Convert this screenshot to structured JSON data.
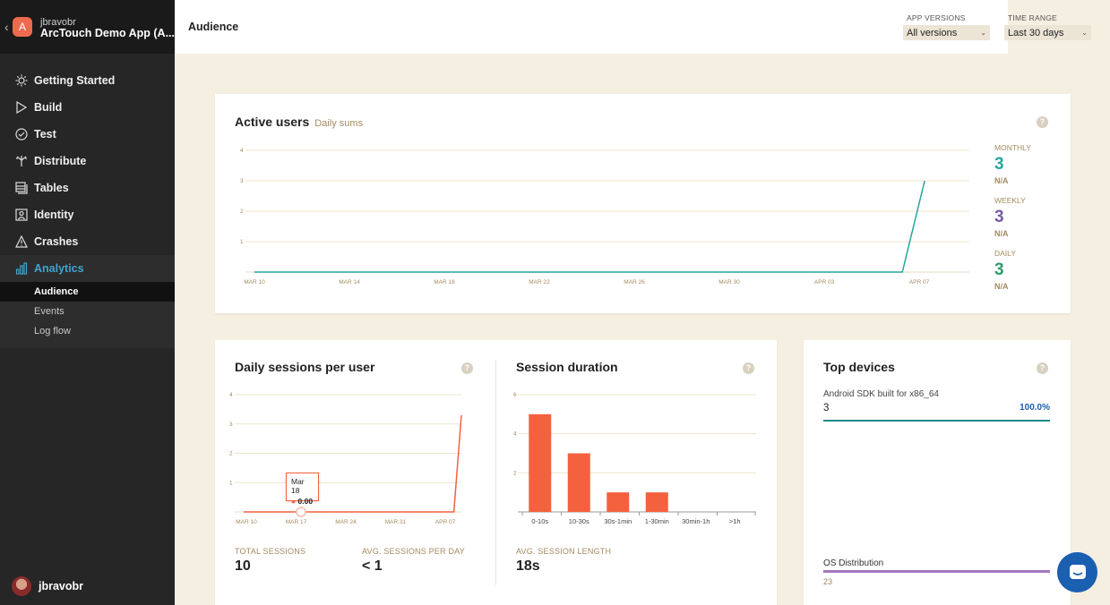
{
  "app": {
    "user": "jbravobr",
    "name": "ArcTouch Demo App (A...",
    "icon_letter": "A"
  },
  "nav": {
    "items": [
      {
        "label": "Getting Started",
        "icon": "sun-icon"
      },
      {
        "label": "Build",
        "icon": "play-icon"
      },
      {
        "label": "Test",
        "icon": "check-circle-icon"
      },
      {
        "label": "Distribute",
        "icon": "distribute-icon"
      },
      {
        "label": "Tables",
        "icon": "tables-icon"
      },
      {
        "label": "Identity",
        "icon": "identity-icon"
      },
      {
        "label": "Crashes",
        "icon": "warning-icon"
      },
      {
        "label": "Analytics",
        "icon": "bar-chart-icon"
      }
    ],
    "sub_items": [
      "Audience",
      "Events",
      "Log flow"
    ]
  },
  "footer": {
    "username": "jbravobr"
  },
  "header": {
    "title": "Audience",
    "app_versions_label": "APP VERSIONS",
    "app_versions_value": "All versions",
    "time_range_label": "TIME RANGE",
    "time_range_value": "Last 30 days"
  },
  "active_users": {
    "title": "Active users",
    "subtitle": "Daily sums",
    "help": "?",
    "legend": [
      {
        "label": "MONTHLY",
        "value": "3",
        "sub": "N/A",
        "color": "#26a69a"
      },
      {
        "label": "WEEKLY",
        "value": "3",
        "sub": "N/A",
        "color": "#7b5ba6"
      },
      {
        "label": "DAILY",
        "value": "3",
        "sub": "N/A",
        "color": "#2e9b6b"
      }
    ]
  },
  "daily_sessions": {
    "title": "Daily sessions per user",
    "help": "?",
    "tooltip_date": "Mar 18",
    "tooltip_value": "0.00",
    "stats": [
      {
        "label": "TOTAL SESSIONS",
        "value": "10"
      },
      {
        "label": "AVG. SESSIONS PER DAY",
        "value": "< 1"
      }
    ]
  },
  "session_duration": {
    "title": "Session duration",
    "help": "?",
    "stat_label": "AVG. SESSION LENGTH",
    "stat_value": "18s"
  },
  "top_devices": {
    "title": "Top devices",
    "help": "?",
    "device_name": "Android SDK built for x86_64",
    "device_count": "3",
    "device_percent": "100.0%",
    "os_label": "OS Distribution",
    "os_value": "23"
  },
  "chart_data": [
    {
      "type": "line",
      "title": "Active users",
      "subtitle": "Daily sums",
      "xticks": [
        "MAR 10",
        "MAR 14",
        "MAR 18",
        "MAR 22",
        "MAR 26",
        "MAR 30",
        "APR 03",
        "APR 07"
      ],
      "yticks": [
        1,
        2,
        3,
        4
      ],
      "ylim": [
        0,
        4
      ],
      "xlim": [
        0,
        32
      ],
      "grid": true,
      "series": [
        {
          "name": "MONTHLY",
          "x": [
            0,
            29,
            30
          ],
          "values": [
            0,
            0,
            3
          ]
        }
      ]
    },
    {
      "type": "line",
      "title": "Daily sessions per user",
      "xticks": [
        "MAR 10",
        "MAR 17",
        "MAR 24",
        "MAR 31",
        "APR 07"
      ],
      "yticks": [
        1,
        2,
        3,
        4
      ],
      "ylim": [
        0,
        4
      ],
      "xlim": [
        0,
        29
      ],
      "grid": true,
      "series": [
        {
          "x": [
            0,
            28,
            29
          ],
          "values": [
            0,
            0,
            3.3
          ]
        }
      ]
    },
    {
      "type": "bar",
      "title": "Session duration",
      "categories": [
        "0-10s",
        "10-30s",
        "30s-1min",
        "1-30min",
        "30min-1h",
        ">1h"
      ],
      "values": [
        5,
        3,
        1,
        1,
        0,
        0
      ],
      "yticks": [
        2,
        4,
        6
      ],
      "ylim": [
        0,
        6
      ],
      "color": "#f4613f"
    }
  ]
}
